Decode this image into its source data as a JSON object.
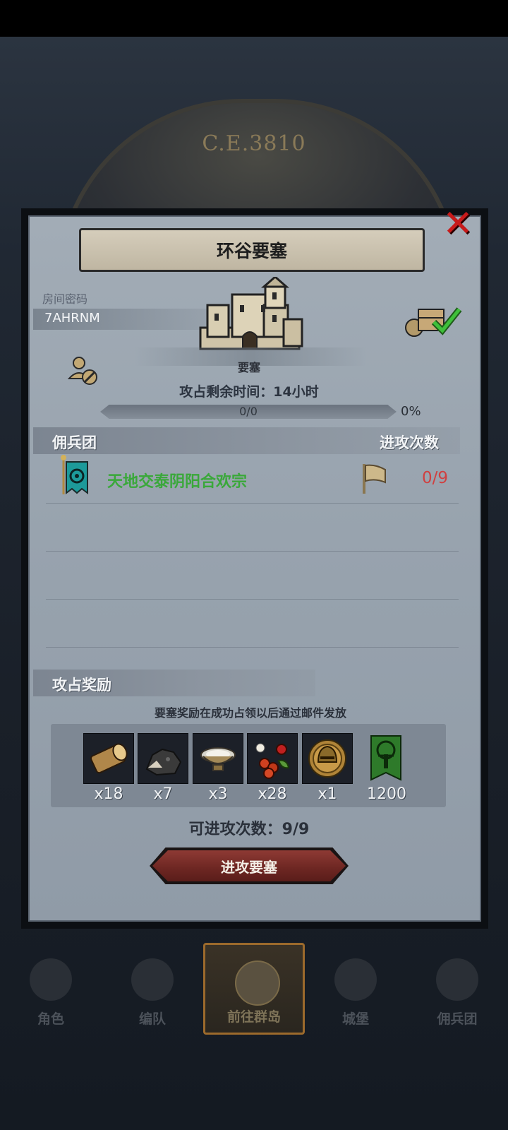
{
  "background": {
    "era": "C.E.3810"
  },
  "panel": {
    "title": "环谷要塞",
    "close_icon": "close-icon",
    "room": {
      "label": "房间密码",
      "code": "7AHRNM"
    },
    "fortress_label": "要塞",
    "time_remaining": "攻占剩余时间：14小时",
    "progress": {
      "text": "0/0",
      "percent": "0%",
      "fraction": 0
    },
    "mercenary_header": "佣兵团",
    "attacks_header": "进攻次数",
    "mercenaries": [
      {
        "name": "天地交泰阴阳合欢宗",
        "attacks": "0/9"
      }
    ],
    "reward_header": "攻占奖励",
    "reward_note": "要塞奖励在成功占领以后通过邮件发放",
    "rewards": [
      {
        "icon": "wood-log-icon",
        "qty": "x18"
      },
      {
        "icon": "ore-chunk-icon",
        "qty": "x7"
      },
      {
        "icon": "silver-bowl-icon",
        "qty": "x3"
      },
      {
        "icon": "berries-icon",
        "qty": "x28"
      },
      {
        "icon": "knight-helmet-icon",
        "qty": "x1"
      },
      {
        "icon": "tree-banner-icon",
        "qty": "1200"
      }
    ],
    "attacks_left": "可进攻次数：9/9",
    "attack_button": "进攻要塞"
  },
  "bottom_nav": {
    "items": [
      {
        "label": "角色",
        "icon": "character-icon"
      },
      {
        "label": "编队",
        "icon": "formation-icon"
      },
      {
        "label": "前往群岛",
        "icon": "islands-map-icon"
      },
      {
        "label": "城堡",
        "icon": "castle-icon"
      },
      {
        "label": "佣兵团",
        "icon": "mercenary-ship-icon"
      }
    ],
    "active_index": 2
  }
}
